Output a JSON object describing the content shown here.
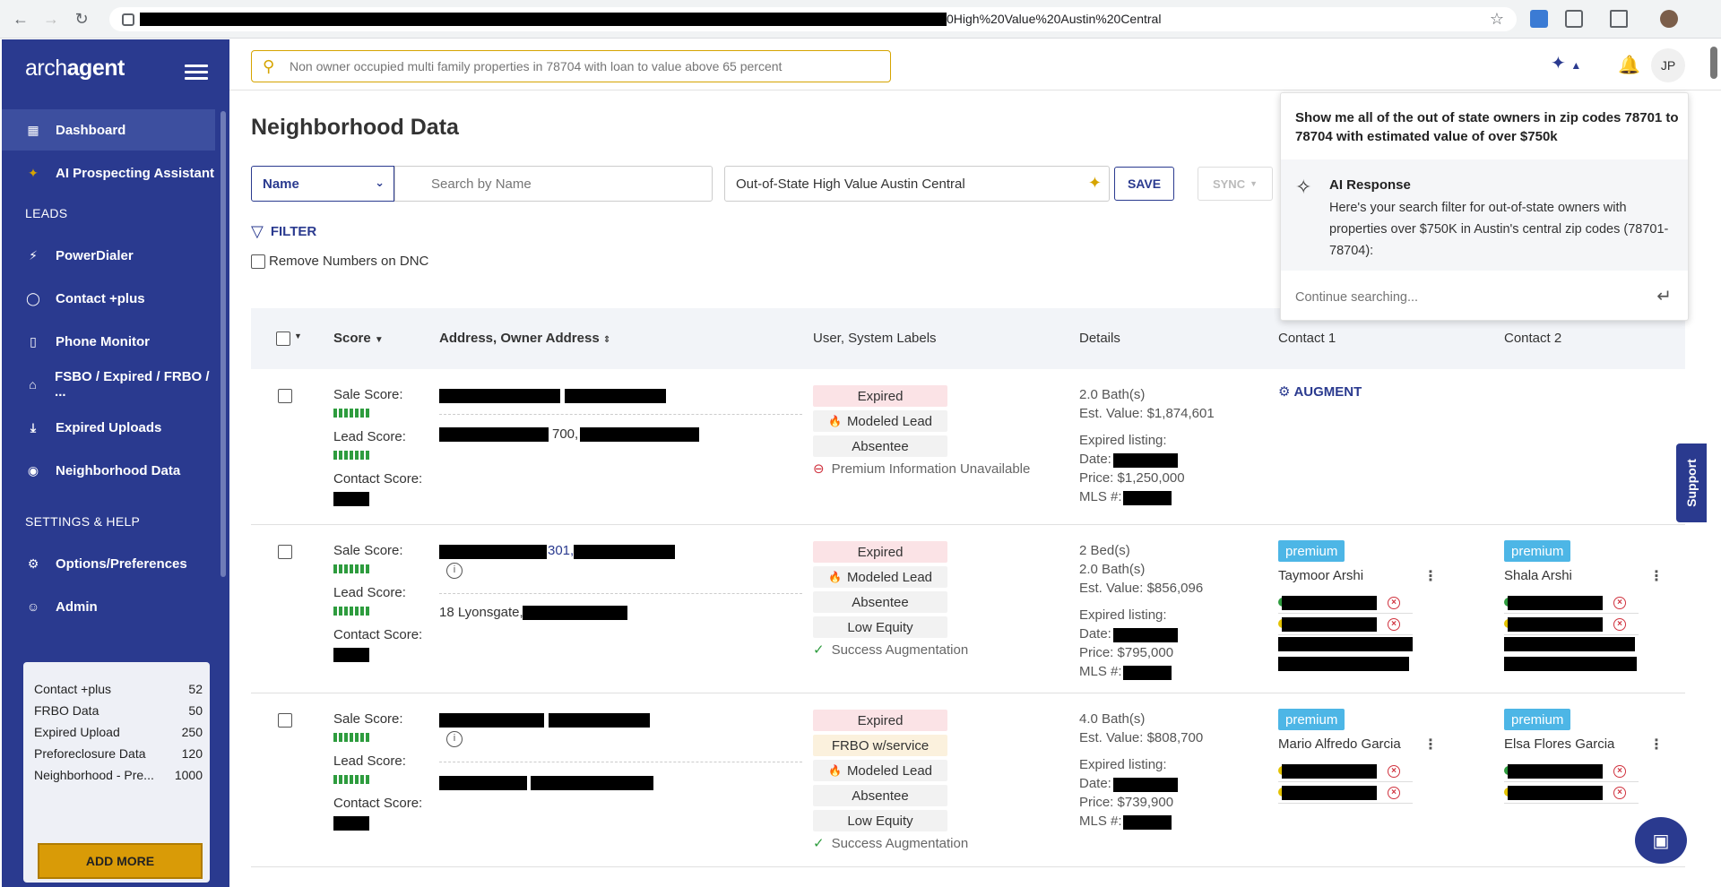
{
  "browser": {
    "url_tail": "0High%20Value%20Austin%20Central"
  },
  "sidebar": {
    "logo_pre": "arch",
    "logo_post": "agent",
    "items": [
      {
        "label": "Dashboard",
        "icon": "dashboard-icon"
      },
      {
        "label": "AI Prospecting Assistant",
        "icon": "sparkle-icon"
      },
      {
        "label": "PowerDialer",
        "icon": "bolt-icon"
      },
      {
        "label": "Contact +plus",
        "icon": "contact-icon"
      },
      {
        "label": "Phone Monitor",
        "icon": "phone-monitor-icon"
      },
      {
        "label": "FSBO / Expired / FRBO / ...",
        "icon": "home-icon"
      },
      {
        "label": "Expired Uploads",
        "icon": "download-icon"
      },
      {
        "label": "Neighborhood Data",
        "icon": "neighborhood-icon"
      },
      {
        "label": "Options/Preferences",
        "icon": "gear-icon"
      },
      {
        "label": "Admin",
        "icon": "user-icon"
      }
    ],
    "section_leads": "LEADS",
    "section_settings": "SETTINGS & HELP",
    "credits": [
      {
        "name": "Contact +plus",
        "value": "52"
      },
      {
        "name": "FRBO Data",
        "value": "50"
      },
      {
        "name": "Expired Upload",
        "value": "250"
      },
      {
        "name": "Preforeclosure Data",
        "value": "120"
      },
      {
        "name": "Neighborhood - Pre...",
        "value": "1000"
      }
    ],
    "add_more": "ADD MORE"
  },
  "header": {
    "ai_placeholder": "Non owner occupied multi family properties in 78704 with loan to value above 65 percent",
    "avatar": "JP"
  },
  "main": {
    "title": "Neighborhood Data",
    "select_value": "Name",
    "search_placeholder": "Search by Name",
    "saved_search": "Out-of-State High Value Austin Central",
    "save": "SAVE",
    "sync": "SYNC",
    "filter": "FILTER",
    "dnc": "Remove Numbers on DNC"
  },
  "table": {
    "headers": {
      "score": "Score",
      "address": "Address, Owner Address",
      "labels": "User, System Labels",
      "details": "Details",
      "contact1": "Contact 1",
      "contact2": "Contact 2"
    },
    "score_labels": {
      "sale": "Sale Score:",
      "lead": "Lead Score:",
      "contact": "Contact Score:"
    },
    "rows": [
      {
        "addr2_mid": "700,",
        "tags": [
          "Expired",
          "Modeled Lead",
          "Absentee"
        ],
        "note": "Premium Information Unavailable",
        "details": [
          "2.0 Bath(s)",
          "Est. Value: $1,874,601",
          "Expired listing:",
          "Date:",
          "Price: $1,250,000",
          "MLS #:"
        ],
        "augment": "AUGMENT"
      },
      {
        "addr1_mid": "301,",
        "addr2": "18 Lyonsgate,",
        "tags": [
          "Expired",
          "Modeled Lead",
          "Absentee",
          "Low Equity"
        ],
        "note": "Success Augmentation",
        "details": [
          "2 Bed(s)",
          "2.0 Bath(s)",
          "Est. Value: $856,096",
          "Expired listing:",
          "Date:",
          "Price: $795,000",
          "MLS #:"
        ],
        "c1_badge": "premium",
        "c1_name": "Taymoor Arshi",
        "c2_badge": "premium",
        "c2_name": "Shala Arshi"
      },
      {
        "tags": [
          "Expired",
          "FRBO w/service",
          "Modeled Lead",
          "Absentee",
          "Low Equity"
        ],
        "note": "Success Augmentation",
        "details": [
          "4.0 Bath(s)",
          "Est. Value: $808,700",
          "Expired listing:",
          "Date:",
          "Price: $739,900",
          "MLS #:"
        ],
        "c1_badge": "premium",
        "c1_name": "Mario Alfredo Garcia",
        "c2_badge": "premium",
        "c2_name": "Elsa Flores Garcia"
      }
    ]
  },
  "ai_popup": {
    "query": "Show me all of the out of state owners in zip codes 78701 to 78704 with estimated value of over $750k",
    "response_title": "AI Response",
    "response_text": "Here's your search filter for out-of-state owners with properties over $750K in Austin's central zip codes (78701-78704):",
    "continue_placeholder": "Continue searching..."
  },
  "support": "Support",
  "colors": {
    "brand": "#2a3a8f",
    "accent": "#d99b07",
    "premium": "#4db6e6",
    "score_green": "#2e9c3e"
  }
}
